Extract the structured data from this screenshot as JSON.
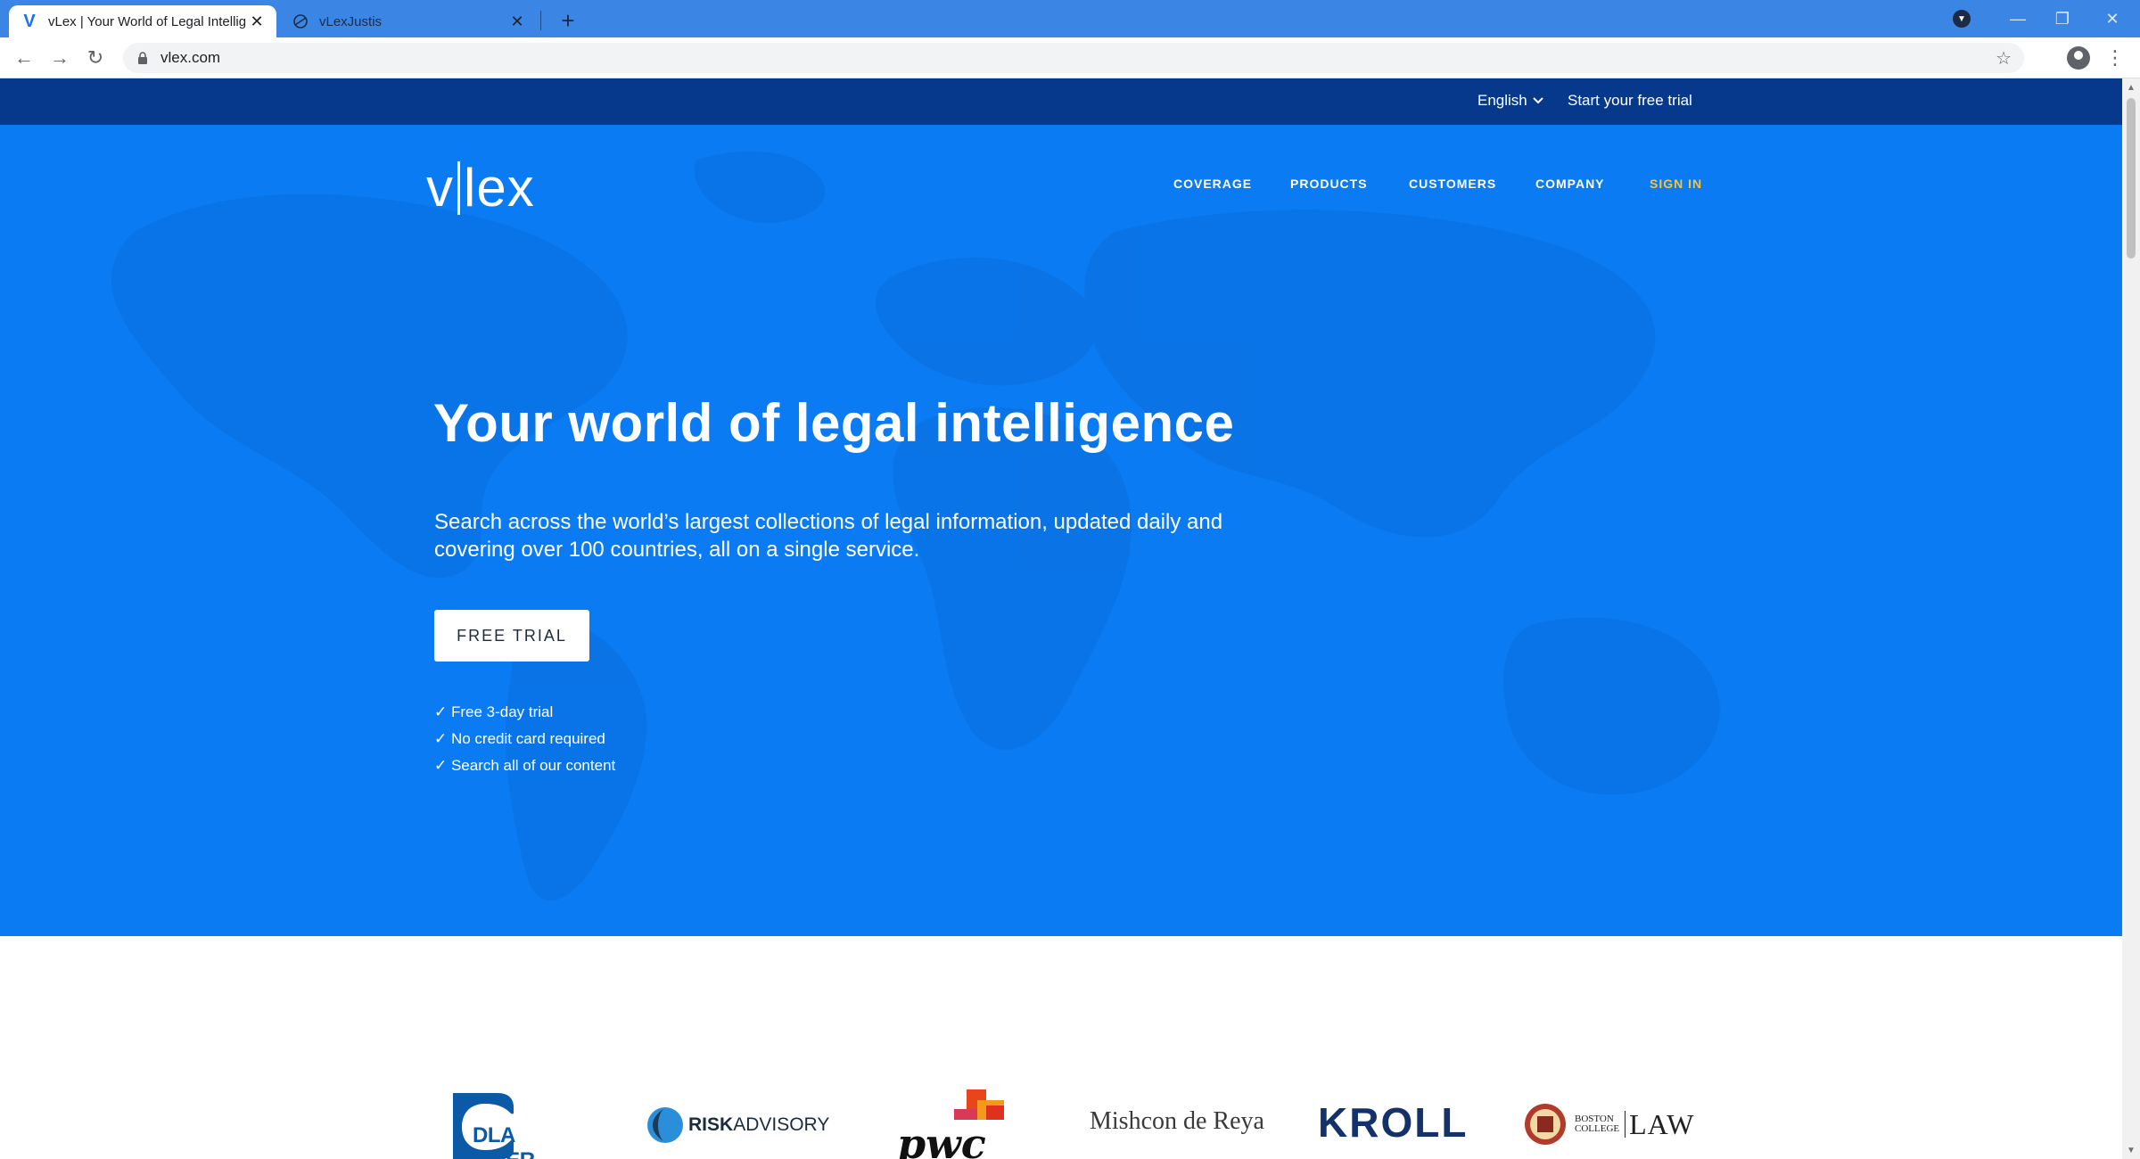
{
  "browser": {
    "tabs": [
      {
        "title": "vLex | Your World of Legal Intellig",
        "favicon": "V",
        "close": "✕"
      },
      {
        "title": "vLexJustis",
        "favicon": "vlexjustis-icon",
        "close": "✕"
      }
    ],
    "new_tab": "+",
    "window_controls": {
      "minimize": "—",
      "restore": "❐",
      "close": "✕"
    },
    "url": "vlex.com",
    "nav": {
      "back": "←",
      "forward": "→",
      "reload": "↻",
      "star": "☆",
      "menu": "⋮"
    }
  },
  "topbar": {
    "language": "English",
    "language_chevron": "⌄",
    "trial_link": "Start your free trial"
  },
  "header": {
    "logo_left": "v",
    "logo_right": "lex",
    "nav": [
      {
        "label": "COVERAGE"
      },
      {
        "label": "PRODUCTS"
      },
      {
        "label": "CUSTOMERS"
      },
      {
        "label": "COMPANY"
      },
      {
        "label": "SIGN IN"
      }
    ]
  },
  "hero": {
    "title": "Your world of legal intelligence",
    "subtitle": "Search across the world’s largest collections of legal information, updated daily and covering over 100 countries, all on a single service.",
    "cta": "FREE TRIAL",
    "checks": [
      "✓ Free 3-day trial",
      "✓ No credit card required",
      "✓ Search all of our content"
    ]
  },
  "clients": {
    "dla": "DLA PIPER",
    "risk_bold": "RISK",
    "risk_light": "ADVISORY",
    "pwc": "pwc",
    "mishcon": "Mishcon de Reya",
    "kroll": "KROLL",
    "bc_small_1": "BOSTON",
    "bc_small_2": "COLLEGE",
    "bc_law": "LAW"
  },
  "colors": {
    "hero_blue": "#0b7bf3",
    "top_strip": "#06398c",
    "sign_in": "#f4c53a",
    "chrome_tabbar": "#3b86e5"
  }
}
